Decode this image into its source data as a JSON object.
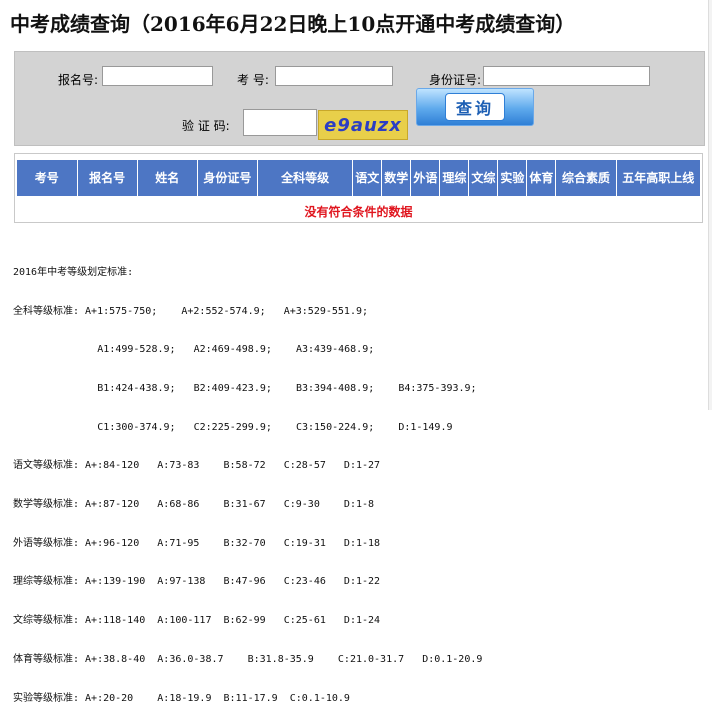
{
  "title": "中考成绩查询（2016年6月22日晚上10点开通中考成绩查询）",
  "form": {
    "registration_no_label": "报名号:",
    "exam_no_label": "考  号:",
    "id_no_label": "身份证号:",
    "captcha_label": "验 证 码:",
    "registration_no_value": "",
    "exam_no_value": "",
    "id_no_value": "",
    "captcha_value": "",
    "captcha_image_text": "e9auzx",
    "query_button": "查询"
  },
  "table": {
    "columns": [
      "考号",
      "报名号",
      "姓名",
      "身份证号",
      "全科等级",
      "语文",
      "数学",
      "外语",
      "理综",
      "文综",
      "实验",
      "体育",
      "综合素质",
      "五年高职上线"
    ],
    "empty_message": "没有符合条件的数据"
  },
  "standards": {
    "heading": "2016年中考等级划定标准:",
    "lines": [
      "全科等级标准: A+1:575-750;    A+2:552-574.9;   A+3:529-551.9;",
      "              A1:499-528.9;   A2:469-498.9;    A3:439-468.9;",
      "              B1:424-438.9;   B2:409-423.9;    B3:394-408.9;    B4:375-393.9;",
      "              C1:300-374.9;   C2:225-299.9;    C3:150-224.9;    D:1-149.9",
      "语文等级标准: A+:84-120   A:73-83    B:58-72   C:28-57   D:1-27",
      "数学等级标准: A+:87-120   A:68-86    B:31-67   C:9-30    D:1-8",
      "外语等级标准: A+:96-120   A:71-95    B:32-70   C:19-31   D:1-18",
      "理综等级标准: A+:139-190  A:97-138   B:47-96   C:23-46   D:1-22",
      "文综等级标准: A+:118-140  A:100-117  B:62-99   C:25-61   D:1-24",
      "体育等级标准: A+:38.8-40  A:36.0-38.7    B:31.8-35.9    C:21.0-31.7   D:0.1-20.9",
      "实验等级标准: A+:20-20    A:18-19.9  B:11-17.9  C:0.1-10.9"
    ]
  }
}
